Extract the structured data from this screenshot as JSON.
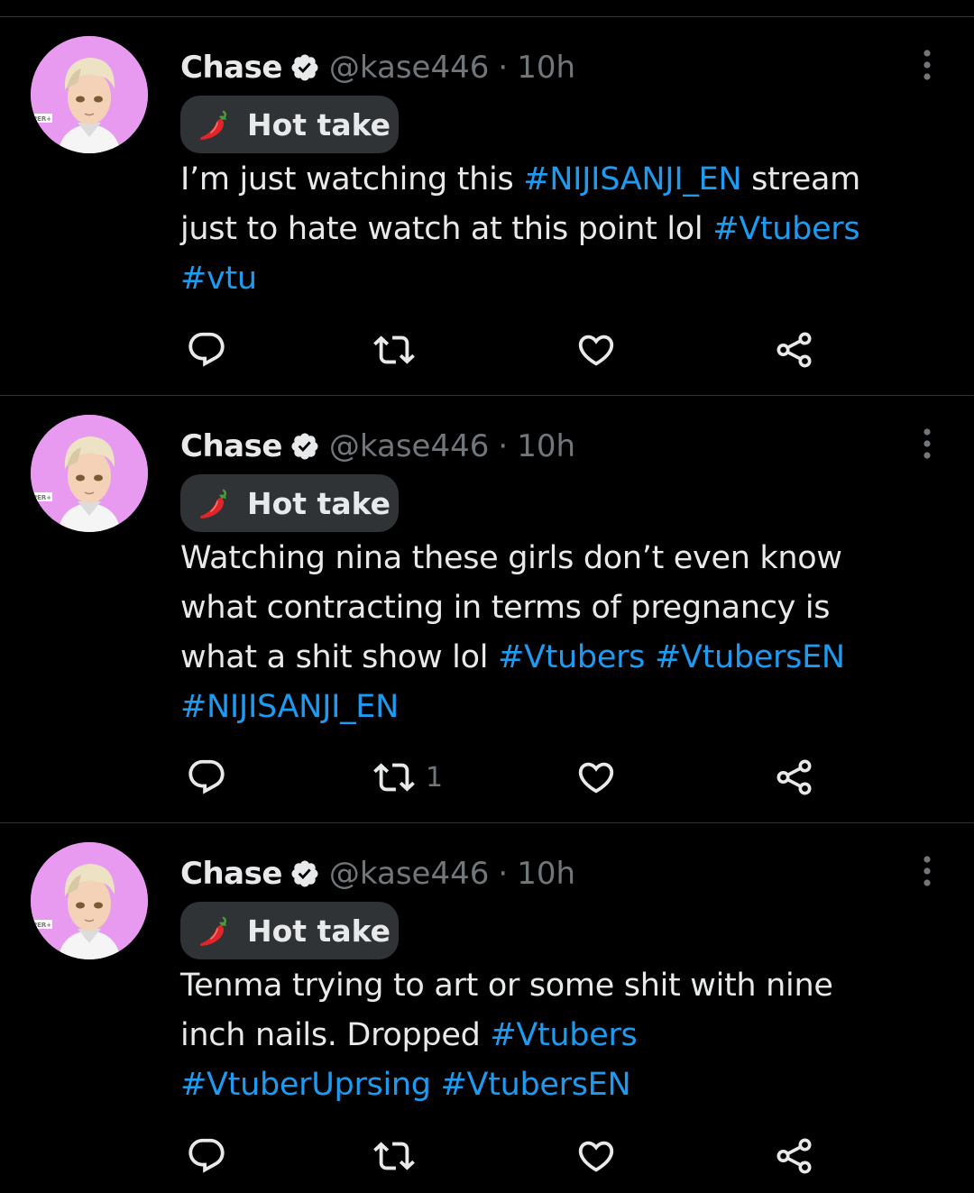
{
  "theme": {
    "background": "#000000",
    "text": "#e7e9ea",
    "muted": "#71767b",
    "accent": "#1d9bf0",
    "divider": "#2f3336",
    "avatar_bg": "#e89af0"
  },
  "tweets": [
    {
      "author_name": "Chase",
      "handle": "@kase446",
      "separator": "·",
      "time": "10h",
      "verified_icon": "verified-badge-icon",
      "more_icon": "more-vertical-icon",
      "tag": {
        "icon": "chili-pepper-icon",
        "label": "Hot take"
      },
      "lines": [
        [
          {
            "t": "I’m just watching this ",
            "h": false
          },
          {
            "t": "#NIJISANJI_EN",
            "h": true
          },
          {
            "t": " stream",
            "h": false
          }
        ],
        [
          {
            "t": "just to hate watch at this point lol ",
            "h": false
          },
          {
            "t": "#Vtubers",
            "h": true
          }
        ],
        [
          {
            "t": "#vtu",
            "h": true
          }
        ]
      ],
      "actions": {
        "reply": "",
        "retweet": "",
        "like": "",
        "share": ""
      }
    },
    {
      "author_name": "Chase",
      "handle": "@kase446",
      "separator": "·",
      "time": "10h",
      "verified_icon": "verified-badge-icon",
      "more_icon": "more-vertical-icon",
      "tag": {
        "icon": "chili-pepper-icon",
        "label": "Hot take"
      },
      "lines": [
        [
          {
            "t": "Watching nina these girls don’t even know",
            "h": false
          }
        ],
        [
          {
            "t": "what contracting in terms of pregnancy is",
            "h": false
          }
        ],
        [
          {
            "t": "what a shit show lol ",
            "h": false
          },
          {
            "t": "#Vtubers",
            "h": true
          },
          {
            "t": " ",
            "h": false
          },
          {
            "t": "#VtubersEN",
            "h": true
          }
        ],
        [
          {
            "t": "#NIJISANJI_EN",
            "h": true
          }
        ]
      ],
      "actions": {
        "reply": "",
        "retweet": "1",
        "like": "",
        "share": ""
      }
    },
    {
      "author_name": "Chase",
      "handle": "@kase446",
      "separator": "·",
      "time": "10h",
      "verified_icon": "verified-badge-icon",
      "more_icon": "more-vertical-icon",
      "tag": {
        "icon": "chili-pepper-icon",
        "label": "Hot take"
      },
      "lines": [
        [
          {
            "t": "Tenma trying to art or some shit with nine",
            "h": false
          }
        ],
        [
          {
            "t": "inch nails. Dropped ",
            "h": false
          },
          {
            "t": "#Vtubers",
            "h": true
          }
        ],
        [
          {
            "t": "#VtuberUprsing",
            "h": true
          },
          {
            "t": " ",
            "h": false
          },
          {
            "t": "#VtubersEN",
            "h": true
          }
        ]
      ],
      "actions": {
        "reply": "",
        "retweet": "",
        "like": "",
        "share": ""
      }
    }
  ]
}
